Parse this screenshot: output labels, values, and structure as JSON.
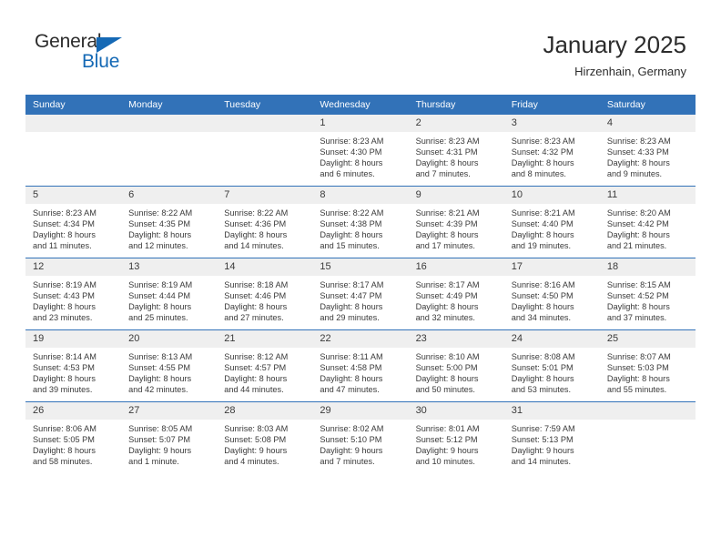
{
  "brand": {
    "name_part1": "General",
    "name_part2": "Blue",
    "logo_icon": "triangle-flag-icon"
  },
  "header": {
    "title": "January 2025",
    "subtitle": "Hirzenhain, Germany"
  },
  "weekday_headers": [
    "Sunday",
    "Monday",
    "Tuesday",
    "Wednesday",
    "Thursday",
    "Friday",
    "Saturday"
  ],
  "colors": {
    "header_bar": "#3272b8",
    "daynum_strip": "#efefef",
    "brand_blue": "#1569b5",
    "text": "#3a3a3a"
  },
  "labels": {
    "sunrise_prefix": "Sunrise:",
    "sunset_prefix": "Sunset:",
    "daylight_prefix": "Daylight:"
  },
  "weeks": [
    [
      {
        "day": "",
        "empty": true
      },
      {
        "day": "",
        "empty": true
      },
      {
        "day": "",
        "empty": true
      },
      {
        "day": "1",
        "sunrise": "Sunrise: 8:23 AM",
        "sunset": "Sunset: 4:30 PM",
        "daylight1": "Daylight: 8 hours",
        "daylight2": "and 6 minutes."
      },
      {
        "day": "2",
        "sunrise": "Sunrise: 8:23 AM",
        "sunset": "Sunset: 4:31 PM",
        "daylight1": "Daylight: 8 hours",
        "daylight2": "and 7 minutes."
      },
      {
        "day": "3",
        "sunrise": "Sunrise: 8:23 AM",
        "sunset": "Sunset: 4:32 PM",
        "daylight1": "Daylight: 8 hours",
        "daylight2": "and 8 minutes."
      },
      {
        "day": "4",
        "sunrise": "Sunrise: 8:23 AM",
        "sunset": "Sunset: 4:33 PM",
        "daylight1": "Daylight: 8 hours",
        "daylight2": "and 9 minutes."
      }
    ],
    [
      {
        "day": "5",
        "sunrise": "Sunrise: 8:23 AM",
        "sunset": "Sunset: 4:34 PM",
        "daylight1": "Daylight: 8 hours",
        "daylight2": "and 11 minutes."
      },
      {
        "day": "6",
        "sunrise": "Sunrise: 8:22 AM",
        "sunset": "Sunset: 4:35 PM",
        "daylight1": "Daylight: 8 hours",
        "daylight2": "and 12 minutes."
      },
      {
        "day": "7",
        "sunrise": "Sunrise: 8:22 AM",
        "sunset": "Sunset: 4:36 PM",
        "daylight1": "Daylight: 8 hours",
        "daylight2": "and 14 minutes."
      },
      {
        "day": "8",
        "sunrise": "Sunrise: 8:22 AM",
        "sunset": "Sunset: 4:38 PM",
        "daylight1": "Daylight: 8 hours",
        "daylight2": "and 15 minutes."
      },
      {
        "day": "9",
        "sunrise": "Sunrise: 8:21 AM",
        "sunset": "Sunset: 4:39 PM",
        "daylight1": "Daylight: 8 hours",
        "daylight2": "and 17 minutes."
      },
      {
        "day": "10",
        "sunrise": "Sunrise: 8:21 AM",
        "sunset": "Sunset: 4:40 PM",
        "daylight1": "Daylight: 8 hours",
        "daylight2": "and 19 minutes."
      },
      {
        "day": "11",
        "sunrise": "Sunrise: 8:20 AM",
        "sunset": "Sunset: 4:42 PM",
        "daylight1": "Daylight: 8 hours",
        "daylight2": "and 21 minutes."
      }
    ],
    [
      {
        "day": "12",
        "sunrise": "Sunrise: 8:19 AM",
        "sunset": "Sunset: 4:43 PM",
        "daylight1": "Daylight: 8 hours",
        "daylight2": "and 23 minutes."
      },
      {
        "day": "13",
        "sunrise": "Sunrise: 8:19 AM",
        "sunset": "Sunset: 4:44 PM",
        "daylight1": "Daylight: 8 hours",
        "daylight2": "and 25 minutes."
      },
      {
        "day": "14",
        "sunrise": "Sunrise: 8:18 AM",
        "sunset": "Sunset: 4:46 PM",
        "daylight1": "Daylight: 8 hours",
        "daylight2": "and 27 minutes."
      },
      {
        "day": "15",
        "sunrise": "Sunrise: 8:17 AM",
        "sunset": "Sunset: 4:47 PM",
        "daylight1": "Daylight: 8 hours",
        "daylight2": "and 29 minutes."
      },
      {
        "day": "16",
        "sunrise": "Sunrise: 8:17 AM",
        "sunset": "Sunset: 4:49 PM",
        "daylight1": "Daylight: 8 hours",
        "daylight2": "and 32 minutes."
      },
      {
        "day": "17",
        "sunrise": "Sunrise: 8:16 AM",
        "sunset": "Sunset: 4:50 PM",
        "daylight1": "Daylight: 8 hours",
        "daylight2": "and 34 minutes."
      },
      {
        "day": "18",
        "sunrise": "Sunrise: 8:15 AM",
        "sunset": "Sunset: 4:52 PM",
        "daylight1": "Daylight: 8 hours",
        "daylight2": "and 37 minutes."
      }
    ],
    [
      {
        "day": "19",
        "sunrise": "Sunrise: 8:14 AM",
        "sunset": "Sunset: 4:53 PM",
        "daylight1": "Daylight: 8 hours",
        "daylight2": "and 39 minutes."
      },
      {
        "day": "20",
        "sunrise": "Sunrise: 8:13 AM",
        "sunset": "Sunset: 4:55 PM",
        "daylight1": "Daylight: 8 hours",
        "daylight2": "and 42 minutes."
      },
      {
        "day": "21",
        "sunrise": "Sunrise: 8:12 AM",
        "sunset": "Sunset: 4:57 PM",
        "daylight1": "Daylight: 8 hours",
        "daylight2": "and 44 minutes."
      },
      {
        "day": "22",
        "sunrise": "Sunrise: 8:11 AM",
        "sunset": "Sunset: 4:58 PM",
        "daylight1": "Daylight: 8 hours",
        "daylight2": "and 47 minutes."
      },
      {
        "day": "23",
        "sunrise": "Sunrise: 8:10 AM",
        "sunset": "Sunset: 5:00 PM",
        "daylight1": "Daylight: 8 hours",
        "daylight2": "and 50 minutes."
      },
      {
        "day": "24",
        "sunrise": "Sunrise: 8:08 AM",
        "sunset": "Sunset: 5:01 PM",
        "daylight1": "Daylight: 8 hours",
        "daylight2": "and 53 minutes."
      },
      {
        "day": "25",
        "sunrise": "Sunrise: 8:07 AM",
        "sunset": "Sunset: 5:03 PM",
        "daylight1": "Daylight: 8 hours",
        "daylight2": "and 55 minutes."
      }
    ],
    [
      {
        "day": "26",
        "sunrise": "Sunrise: 8:06 AM",
        "sunset": "Sunset: 5:05 PM",
        "daylight1": "Daylight: 8 hours",
        "daylight2": "and 58 minutes."
      },
      {
        "day": "27",
        "sunrise": "Sunrise: 8:05 AM",
        "sunset": "Sunset: 5:07 PM",
        "daylight1": "Daylight: 9 hours",
        "daylight2": "and 1 minute."
      },
      {
        "day": "28",
        "sunrise": "Sunrise: 8:03 AM",
        "sunset": "Sunset: 5:08 PM",
        "daylight1": "Daylight: 9 hours",
        "daylight2": "and 4 minutes."
      },
      {
        "day": "29",
        "sunrise": "Sunrise: 8:02 AM",
        "sunset": "Sunset: 5:10 PM",
        "daylight1": "Daylight: 9 hours",
        "daylight2": "and 7 minutes."
      },
      {
        "day": "30",
        "sunrise": "Sunrise: 8:01 AM",
        "sunset": "Sunset: 5:12 PM",
        "daylight1": "Daylight: 9 hours",
        "daylight2": "and 10 minutes."
      },
      {
        "day": "31",
        "sunrise": "Sunrise: 7:59 AM",
        "sunset": "Sunset: 5:13 PM",
        "daylight1": "Daylight: 9 hours",
        "daylight2": "and 14 minutes."
      },
      {
        "day": "",
        "empty": true
      }
    ]
  ]
}
